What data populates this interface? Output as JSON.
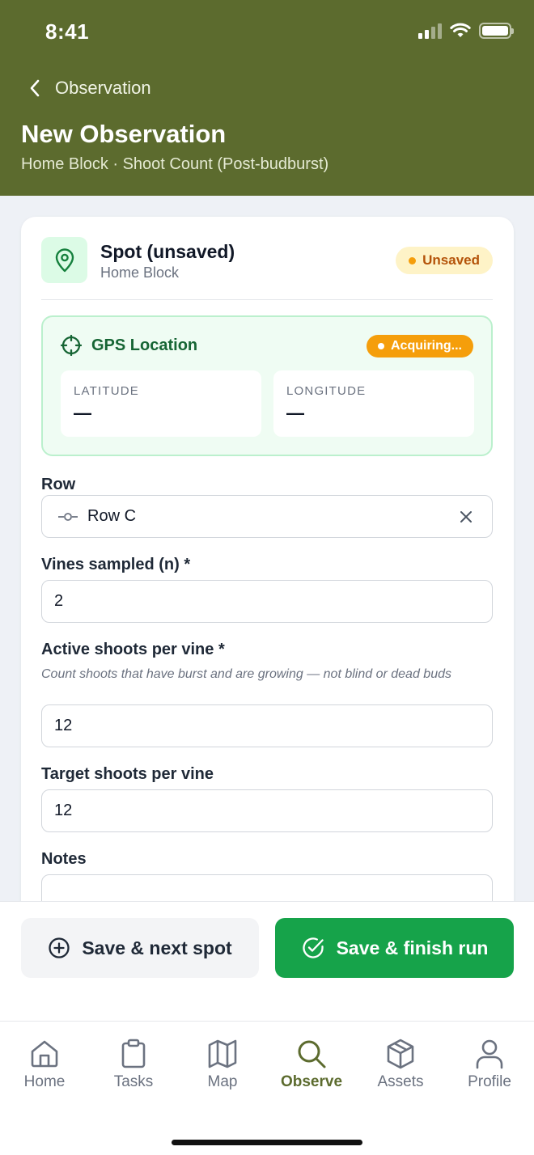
{
  "status_bar": {
    "time": "8:41"
  },
  "header": {
    "back_label": "Observation",
    "title": "New Observation",
    "subtitle": "Home Block · Shoot Count (Post-budburst)"
  },
  "spot": {
    "title": "Spot (unsaved)",
    "block": "Home Block",
    "badge": "Unsaved"
  },
  "gps": {
    "title": "GPS Location",
    "status": "Acquiring...",
    "latitude_label": "LATITUDE",
    "latitude_value": "—",
    "longitude_label": "LONGITUDE",
    "longitude_value": "—"
  },
  "form": {
    "row_label": "Row",
    "row_value": "Row C",
    "vines_label": "Vines sampled (n) *",
    "vines_value": "2",
    "active_label": "Active shoots per vine *",
    "active_hint": "Count shoots that have burst and are growing — not blind or dead buds",
    "active_value": "12",
    "target_label": "Target shoots per vine",
    "target_value": "12",
    "notes_label": "Notes",
    "notes_value": ""
  },
  "actions": {
    "secondary_label": "Save & next spot",
    "primary_label": "Save & finish run"
  },
  "tabs": [
    {
      "label": "Home",
      "icon": "home-icon"
    },
    {
      "label": "Tasks",
      "icon": "clipboard-icon"
    },
    {
      "label": "Map",
      "icon": "map-icon"
    },
    {
      "label": "Observe",
      "icon": "search-icon",
      "active": true
    },
    {
      "label": "Assets",
      "icon": "box-icon"
    },
    {
      "label": "Profile",
      "icon": "user-icon"
    }
  ],
  "colors": {
    "header_bg": "#5c6b2e",
    "primary_green": "#16a34a",
    "badge_amber": "#f59e0b"
  }
}
